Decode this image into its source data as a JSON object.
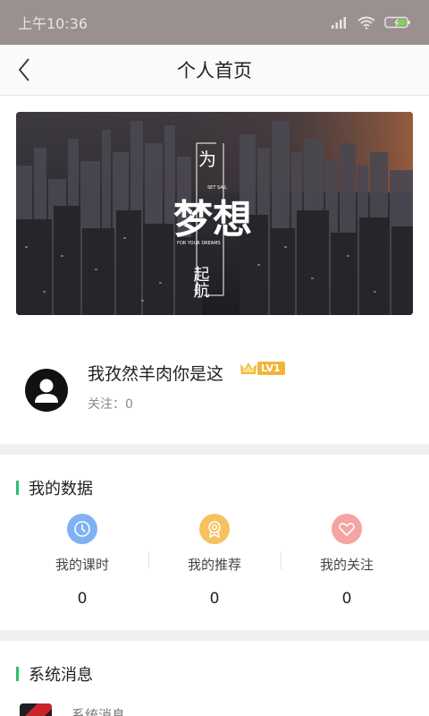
{
  "status_bar": {
    "time": "上午10:36"
  },
  "nav": {
    "title": "个人首页"
  },
  "banner": {
    "top_char": "为",
    "main_text": "梦想",
    "bottom_chars": "起航",
    "en_small_top": "SET SAIL",
    "en_small_bottom": "FOR YOUR DREAMS"
  },
  "profile": {
    "name": "我孜然羊肉你是这",
    "level": "LV1",
    "follow": "关注：0"
  },
  "my_data": {
    "title": "我的数据",
    "items": [
      {
        "label": "我的课时",
        "value": "0",
        "icon": "clock-icon",
        "color": "#7fb1f4"
      },
      {
        "label": "我的推荐",
        "value": "0",
        "icon": "medal-icon",
        "color": "#f6c25e"
      },
      {
        "label": "我的关注",
        "value": "0",
        "icon": "heart-icon",
        "color": "#f5a3a3"
      }
    ]
  },
  "messages": {
    "title": "系统消息",
    "items": [
      {
        "label": "系统消息"
      }
    ]
  }
}
